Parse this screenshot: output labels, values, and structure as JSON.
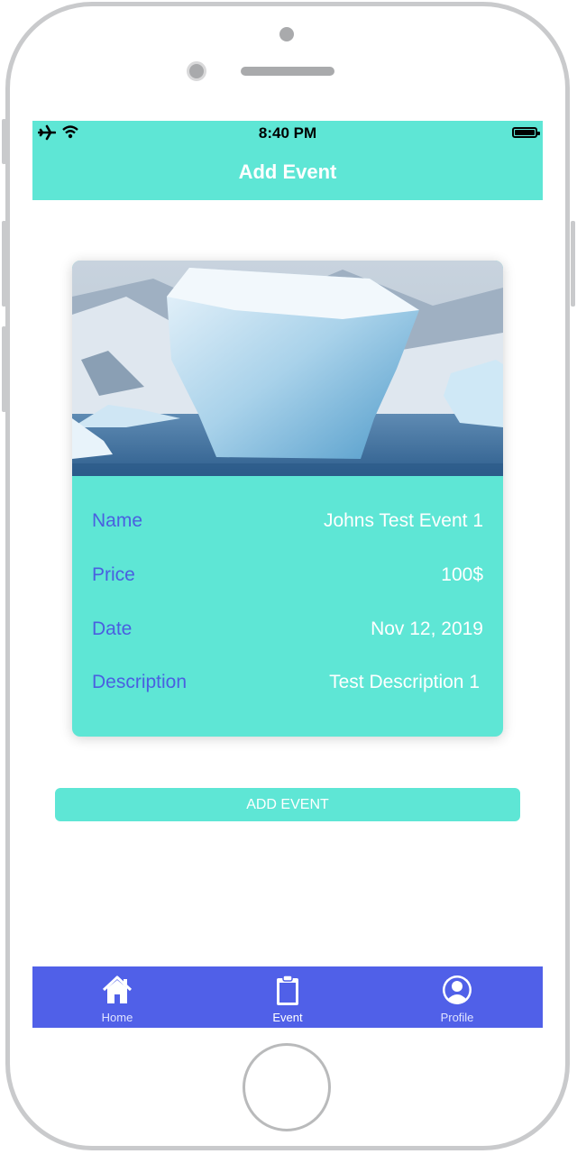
{
  "status_bar": {
    "time": "8:40 PM"
  },
  "nav": {
    "title": "Add Event"
  },
  "event": {
    "fields": [
      {
        "label": "Name",
        "value": "Johns Test Event 1"
      },
      {
        "label": "Price",
        "value": "100$"
      },
      {
        "label": "Date",
        "value": "Nov 12, 2019"
      },
      {
        "label": "Description",
        "value": "Test Description 1"
      }
    ]
  },
  "add_button": {
    "label": "ADD EVENT"
  },
  "tabs": [
    {
      "label": "Home",
      "icon": "home-icon",
      "active": false
    },
    {
      "label": "Event",
      "icon": "clipboard-icon",
      "active": true
    },
    {
      "label": "Profile",
      "icon": "profile-icon",
      "active": false
    }
  ],
  "colors": {
    "accent": "#5ee6d5",
    "tabbar": "#5060e8",
    "label": "#4a5fe0"
  }
}
